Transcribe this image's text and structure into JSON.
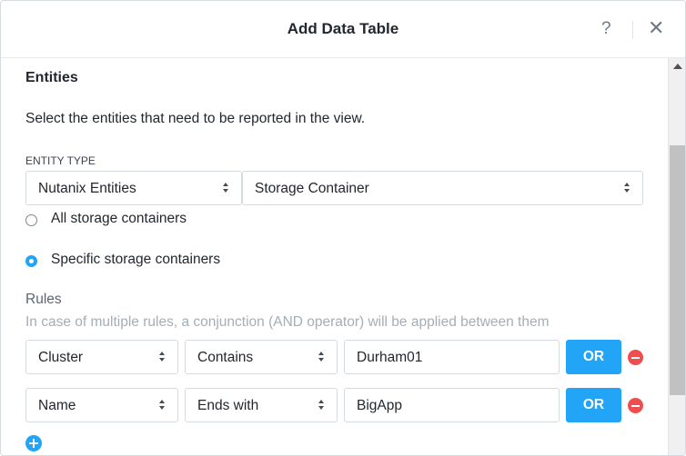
{
  "dialog": {
    "title": "Add Data Table",
    "help_label": "?",
    "close_label": "✕"
  },
  "entities": {
    "title": "Entities",
    "description": "Select the entities that need to be reported in the view.",
    "entity_type_label": "ENTITY TYPE",
    "entity_source": "Nutanix Entities",
    "entity_type": "Storage Container",
    "radio_options": [
      {
        "label": "All storage containers",
        "selected": false
      },
      {
        "label": "Specific storage containers",
        "selected": true
      }
    ]
  },
  "rules": {
    "title": "Rules",
    "hint": "In case of multiple rules, a conjunction (AND operator) will be applied between them",
    "or_label": "OR",
    "rows": [
      {
        "attribute": "Cluster",
        "operator": "Contains",
        "value": "Durham01"
      },
      {
        "attribute": "Name",
        "operator": "Ends with",
        "value": "BigApp"
      }
    ]
  },
  "colors": {
    "accent": "#22a5f7",
    "remove": "#ef4e4e"
  },
  "icons": {
    "help": "question-mark-icon",
    "close": "close-icon",
    "remove": "minus-circle-icon",
    "add": "plus-circle-icon",
    "select_caret": "up-down-caret-icon"
  }
}
